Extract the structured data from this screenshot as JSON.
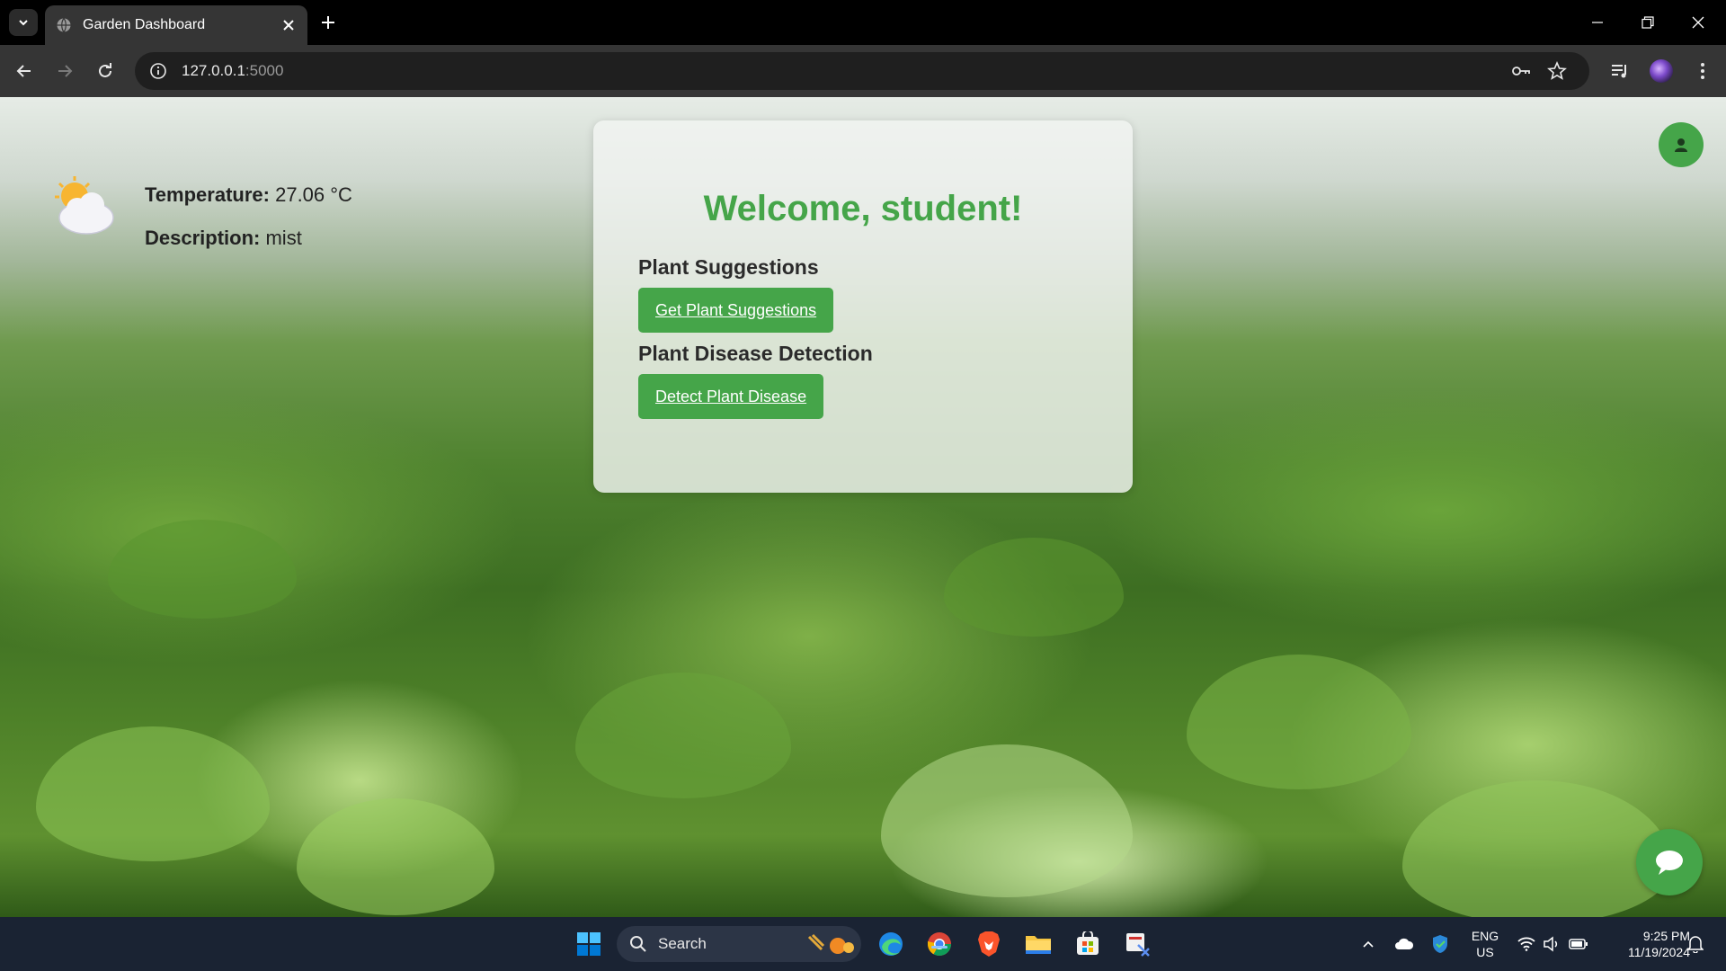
{
  "browser": {
    "tab_title": "Garden Dashboard",
    "url_host": "127.0.0.1",
    "url_port": ":5000"
  },
  "weather": {
    "icon": "partly-cloudy-icon",
    "temperature_label": "Temperature:",
    "temperature_value": "27.06 °C",
    "description_label": "Description:",
    "description_value": "mist"
  },
  "card": {
    "title": "Welcome, student!",
    "sections": [
      {
        "heading": "Plant Suggestions",
        "button": "Get Plant Suggestions"
      },
      {
        "heading": "Plant Disease Detection",
        "button": "Detect Plant Disease"
      }
    ]
  },
  "colors": {
    "accent": "#45a549",
    "taskbar": "#1a2333",
    "chrome_toolbar": "#353535"
  },
  "taskbar": {
    "search_placeholder": "Search",
    "lang_line1": "ENG",
    "lang_line2": "US",
    "time": "9:25 PM",
    "date": "11/19/2024"
  }
}
